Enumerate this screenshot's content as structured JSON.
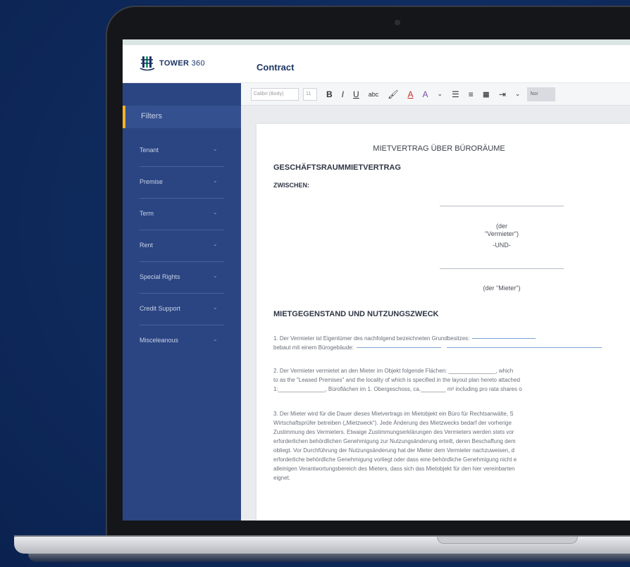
{
  "app": {
    "logo_text": "TOWER",
    "logo_num": "360",
    "tab": "Contract"
  },
  "sidebar": {
    "filters_label": "Filters",
    "items": [
      {
        "label": "Tenant"
      },
      {
        "label": "Premise"
      },
      {
        "label": "Term"
      },
      {
        "label": "Rent"
      },
      {
        "label": "Special Rights"
      },
      {
        "label": "Credit Support"
      },
      {
        "label": "Misceleanous"
      }
    ]
  },
  "toolbar": {
    "font": "Calibri (Body)",
    "size": "11",
    "bold": "B",
    "italic": "I",
    "underline": "U",
    "strike": "abc",
    "font_color": "A",
    "highlight": "A",
    "style": "Nor"
  },
  "document": {
    "title": "MIETVERTRAG ÜBER BÜRORÄUME",
    "heading1": "GESCHÄFTSRAUMMIETVERTRAG",
    "between": "ZWISCHEN:",
    "party1_a": "(der",
    "party1_b": "\"Vermieter\")",
    "und": "-UND-",
    "party2": "(der \"Mieter\")",
    "heading2": "MIETGEGENSTAND UND NUTZUNGSZWECK",
    "p1_l1": "1. Der Vermieter ist Eigentümer des nachfolgend bezeichneten Grundbesitzes:",
    "p1_l2": "bebaut mit einem Bürogebäude:",
    "p2_l1": "2. Der Vermieter vermietet an den Mieter im Objekt folgende Flächen: _______________, which",
    "p2_l2": "to as the \"Leased Premises\" and the locality of which is specified in the layout plan hereto attached",
    "p2_l3": "1:_______________, Büroflächen im 1. Obergeschoss, ca.________ m² including pro rata shares o",
    "p3_l1": "3. Der Mieter wird für die Dauer dieses Mietvertrags im Mietobjekt ein Büro für Rechtsanwälte, S",
    "p3_l2": "Wirtschaftsprüfer betreiben („Mietzweck“). Jede Änderung des Mietzwecks bedarf der vorherige",
    "p3_l3": "Zustimmung des Vermieters. Etwaige Zustimmungserklärungen des Vermieters werden stets vor",
    "p3_l4": "erforderlichen behördlichen Genehmigung zur Nutzungsänderung erteilt, deren Beschaffung dem",
    "p3_l5": "obliegt. Vor Durchführung der Nutzungsänderung hat der Mieter dem Vermieter nachzuweisen, d",
    "p3_l6": "erforderliche behördliche Genehmigung vorliegt oder dass eine behördliche Genehmigung nicht e",
    "p3_l7": "alleinigen Verantwortungsbereich des Mieters, dass sich das Mietobjekt für den hier vereinbarten",
    "p3_l8": "eignet."
  }
}
